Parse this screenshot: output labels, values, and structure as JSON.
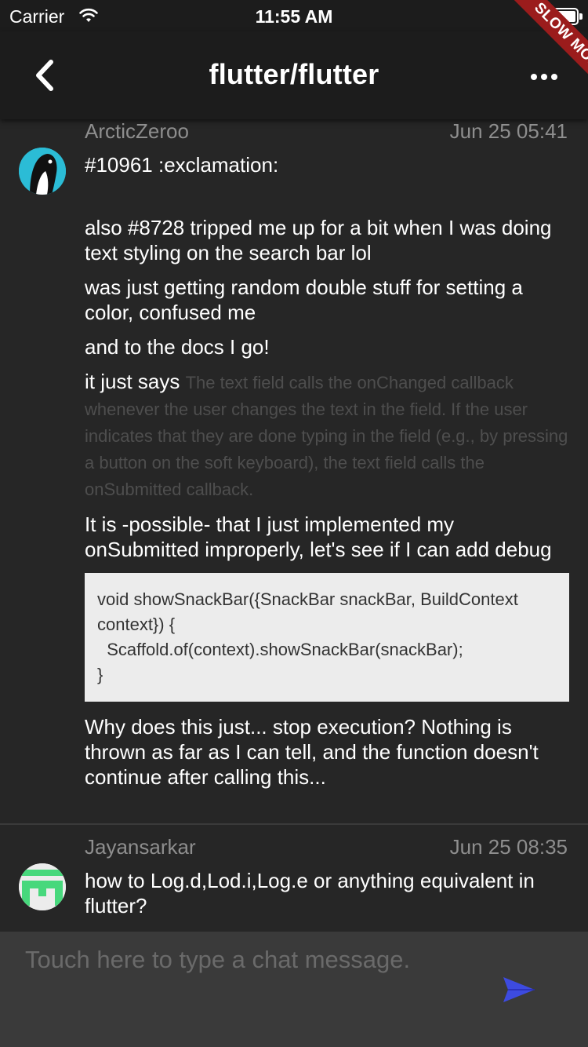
{
  "status_bar": {
    "carrier": "Carrier",
    "time": "11:55 AM"
  },
  "app_bar": {
    "title": "flutter/flutter"
  },
  "debug_banner": "SLOW MODE",
  "messages": [
    {
      "author": "ArcticZeroo",
      "time": "Jun 25 05:41",
      "avatar": "penguin-avatar-icon",
      "lines": [
        "#10961 :exclamation:",
        "also #8728 tripped me up for a bit when I was doing text styling on the search bar lol",
        "was just getting random double stuff for setting a color, confused me",
        "and to the docs I go!",
        "it just says",
        "It is -possible- that I just implemented my onSubmitted improperly, let's see if I can add debug",
        "Why does this just... stop execution? Nothing is thrown as far as I can tell, and the function doesn't continue after calling this..."
      ],
      "quote": "The text field calls the onChanged callback whenever the user changes the text in the field. If the user indicates that they are done typing in the field (e.g., by pressing a button on the soft keyboard), the text field calls the onSubmitted callback.",
      "code": "void showSnackBar({SnackBar snackBar, BuildContext context}) {\n  Scaffold.of(context).showSnackBar(snackBar);\n}"
    },
    {
      "author": "Jayansarkar",
      "time": "Jun 25 08:35",
      "avatar": "pixel-avatar-icon",
      "text": "how to Log.d,Lod.i,Log.e or anything equivalent in flutter?"
    }
  ],
  "composer": {
    "placeholder": "Touch here to type a chat message."
  },
  "colors": {
    "background": "#262626",
    "bar": "#1c1c1c",
    "composer": "#3a3a3a",
    "send": "#3d4be0",
    "ribbon": "#9b1c1c"
  }
}
